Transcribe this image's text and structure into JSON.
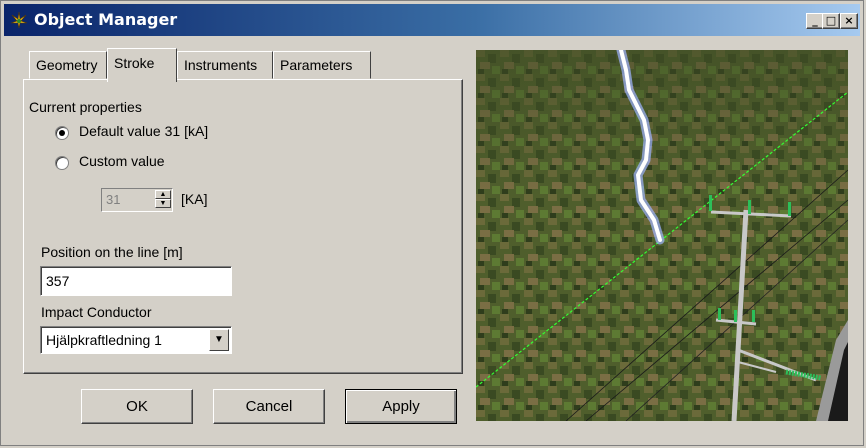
{
  "window": {
    "title": "Object Manager",
    "controls": {
      "minimize": "_",
      "maximize": "□",
      "close": "×"
    }
  },
  "tabs": [
    {
      "label": "Geometry",
      "active": false
    },
    {
      "label": "Stroke",
      "active": true
    },
    {
      "label": "Instruments",
      "active": false
    },
    {
      "label": "Parameters",
      "active": false
    }
  ],
  "stroke": {
    "section_label": "Current properties",
    "default_option": {
      "label": "Default value  31 [kA]",
      "selected": true
    },
    "custom_option": {
      "label": "Custom value",
      "selected": false
    },
    "custom_value": "31",
    "custom_unit": "[KA]",
    "position_label": "Position on the line [m]",
    "position_value": "357",
    "conductor_label": "Impact Conductor",
    "conductor_value": "Hjälpkraftledning 1"
  },
  "buttons": {
    "ok": "OK",
    "cancel": "Cancel",
    "apply": "Apply"
  },
  "view": {
    "ground_color": "#4a5a2a",
    "lightning_color": "#ffffff",
    "line_marker_color": "#33ff33"
  }
}
